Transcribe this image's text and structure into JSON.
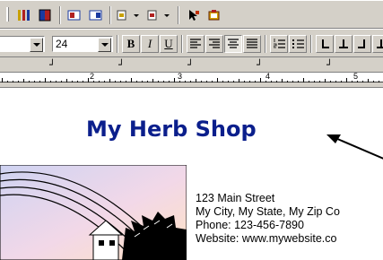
{
  "toolbar_top": {
    "icons": [
      "column-bars-icon",
      "table-color-icon",
      "frame-a-icon",
      "frame-b-icon",
      "object-insert-icon",
      "object-insert-alt-icon",
      "pointer-tool-icon",
      "image-insert-icon"
    ]
  },
  "formatting_bar": {
    "font_name": "",
    "font_size": "24",
    "bold_label": "B",
    "italic_label": "I",
    "underline_label": "U"
  },
  "ruler": {
    "numbers": [
      "2",
      "3",
      "4",
      "5"
    ]
  },
  "document": {
    "title": "My Herb Shop",
    "address": {
      "street": "123 Main Street",
      "city": "My City, My State, My Zip Co",
      "phone": "Phone: 123-456-7890",
      "website": "Website: www.mywebsite.co"
    }
  },
  "colors": {
    "title": "#0b1f8c",
    "chrome": "#d4d0c8"
  }
}
